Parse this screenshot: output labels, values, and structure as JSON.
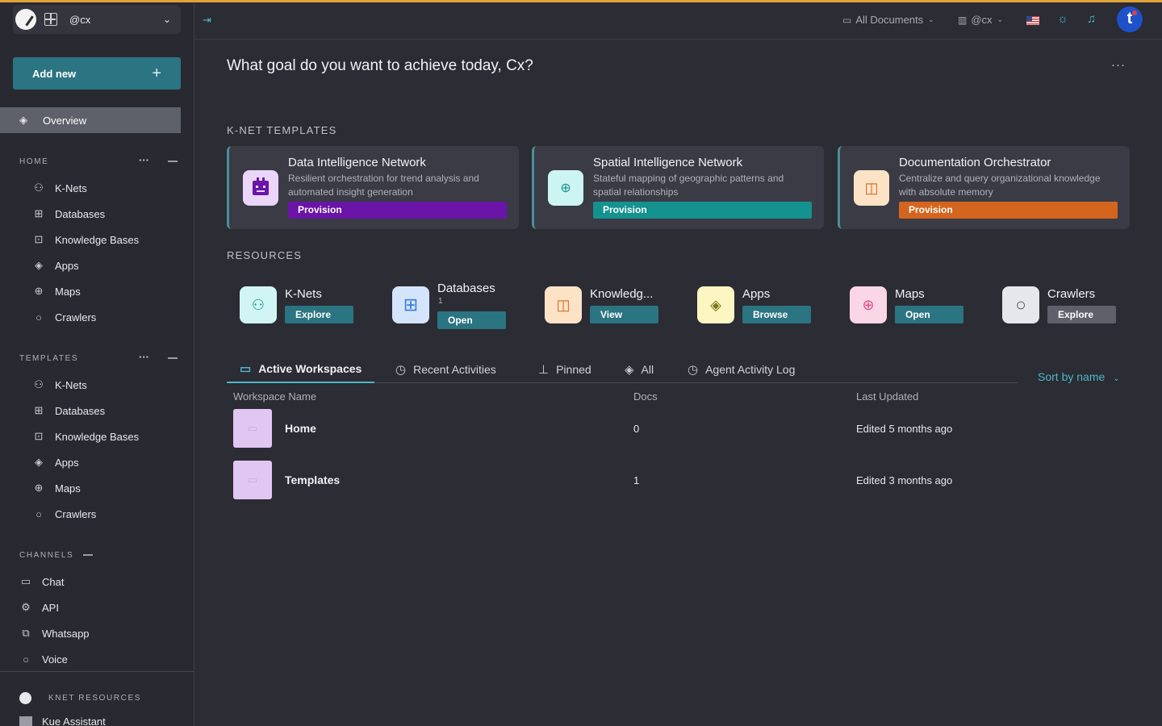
{
  "colors": {
    "accent": "#2b7481",
    "accent_light": "#4fb5c7",
    "top_line": "#e0a33a",
    "purple": "#6a14a8",
    "teal": "#14928f",
    "orange": "#d4651e"
  },
  "workspace": {
    "name": "@cx"
  },
  "sidebar": {
    "add_new": "Add new",
    "overview": "Overview",
    "home_label": "HOME",
    "home_items": [
      "K-Nets",
      "Databases",
      "Knowledge Bases",
      "Apps",
      "Maps",
      "Crawlers"
    ],
    "templates_label": "TEMPLATES",
    "template_items": [
      "K-Nets",
      "Databases",
      "Knowledge Bases",
      "Apps",
      "Maps",
      "Crawlers"
    ],
    "channels_label": "CHANNELS",
    "channels": [
      "Chat",
      "API",
      "Whatsapp",
      "Voice"
    ],
    "knet_resources_label": "KNET RESOURCES",
    "kue_assistant": "Kue Assistant"
  },
  "topbar": {
    "all_documents": "All Documents",
    "user": "@cx",
    "avatar_letter": "t"
  },
  "main": {
    "greeting": "What goal do you want to achieve today, Cx?",
    "more": "···",
    "knet_templates_label": "K-NET TEMPLATES",
    "templates": [
      {
        "title": "Data Intelligence Network",
        "description": "Resilient orchestration for trend analysis and automated insight generation",
        "action": "Provision"
      },
      {
        "title": "Spatial Intelligence Network",
        "description": "Stateful mapping of geographic patterns and spatial relationships",
        "action": "Provision"
      },
      {
        "title": "Documentation Orchestrator",
        "description": "Centralize and query organizational knowledge with absolute memory",
        "action": "Provision"
      }
    ],
    "resources_label": "RESOURCES",
    "resources": [
      {
        "name": "K-Nets",
        "count": "",
        "action": "Explore"
      },
      {
        "name": "Databases",
        "count": "1",
        "action": "Open"
      },
      {
        "name": "Knowledg...",
        "count": "",
        "action": "View"
      },
      {
        "name": "Apps",
        "count": "",
        "action": "Browse"
      },
      {
        "name": "Maps",
        "count": "",
        "action": "Open"
      },
      {
        "name": "Crawlers",
        "count": "",
        "action": "Explore"
      }
    ],
    "tabs": [
      "Active Workspaces",
      "Recent Activities",
      "Pinned",
      "All",
      "Agent Activity Log"
    ],
    "sort": "Sort by name",
    "table": {
      "headers": [
        "Workspace Name",
        "Docs",
        "Last Updated"
      ],
      "rows": [
        {
          "name": "Home",
          "docs": "0",
          "updated": "Edited 5 months ago"
        },
        {
          "name": "Templates",
          "docs": "1",
          "updated": "Edited 3 months ago"
        }
      ]
    }
  }
}
